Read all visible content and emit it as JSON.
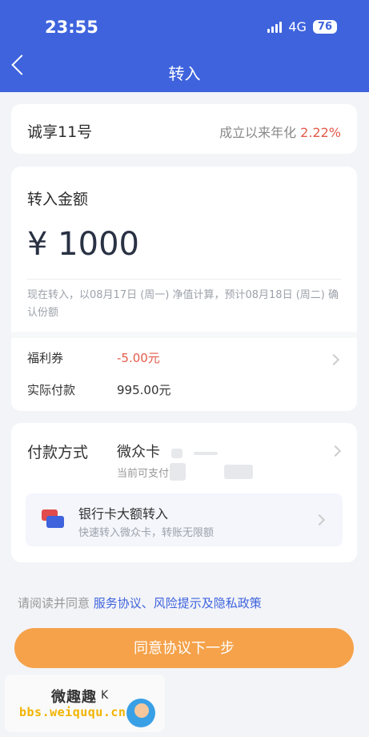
{
  "status_bar": {
    "time": "23:55",
    "network": "4G",
    "battery": "76"
  },
  "nav": {
    "title": "转入"
  },
  "product": {
    "name": "诚享11号",
    "rate_label": "成立以来年化",
    "rate_value": "2.22%"
  },
  "amount": {
    "label": "转入金额",
    "value": "¥ 1000",
    "tip": "现在转入，以08月17日 (周一) 净值计算，预计08月18日 (周二) 确认份额"
  },
  "rows": [
    {
      "label": "福利券",
      "value": "-5.00元"
    },
    {
      "label": "实际付款",
      "value": "995.00元"
    }
  ],
  "payment": {
    "label": "付款方式",
    "card_name": "微众卡",
    "available_label": "当前可支付",
    "transfer_title": "银行卡大额转入",
    "transfer_sub": "快速转入微众卡，转账无限额"
  },
  "agreement": {
    "prefix": "请阅读并同意 ",
    "link": "服务协议、风险提示及隐私政策"
  },
  "cta": {
    "label": "同意协议下一步"
  },
  "watermark": {
    "title": "微趣趣",
    "url": "bbs.weiququ.cn",
    "extra": "K"
  }
}
